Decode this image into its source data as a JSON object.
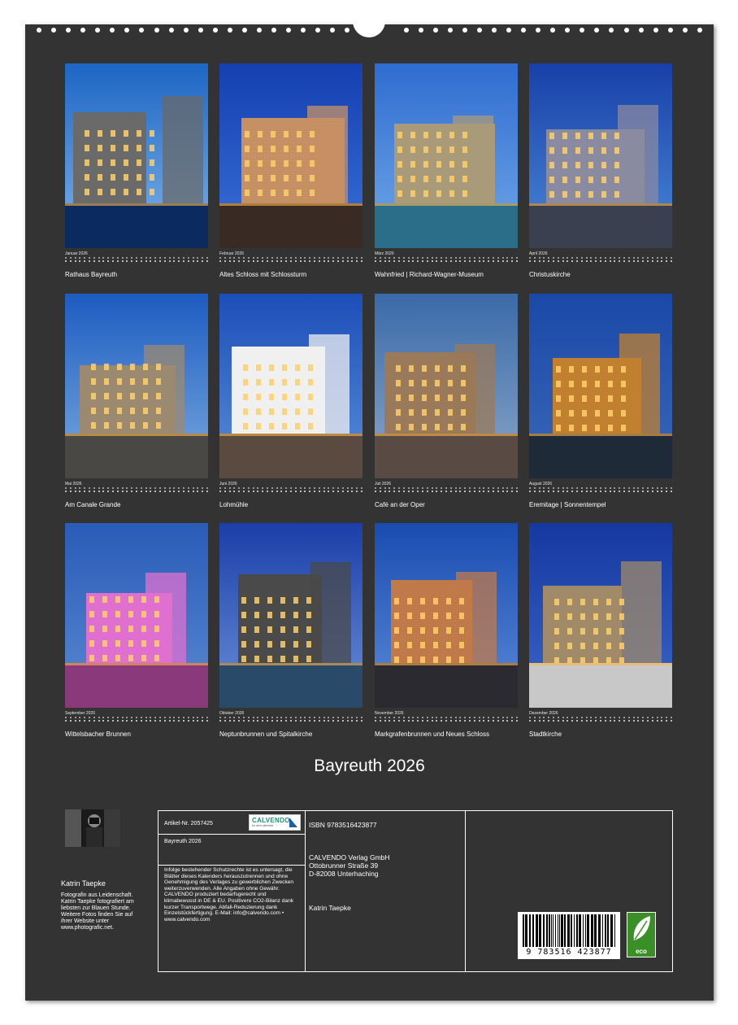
{
  "calendar": {
    "title": "Bayreuth 2026",
    "months": [
      {
        "month_label": "Januar 2026",
        "caption": "Rathaus Bayreuth",
        "sky": "#1d66c4",
        "sky_low": "#7db2ea",
        "ground": "#0b2a60",
        "accent": "#6a6a6a"
      },
      {
        "month_label": "Februar 2026",
        "caption": "Altes Schloss mit Schlossturm",
        "sky": "#1440b0",
        "sky_low": "#3a70d8",
        "ground": "#3a2a24",
        "accent": "#c59064"
      },
      {
        "month_label": "März 2026",
        "caption": "Wahnfried | Richard-Wagner-Museum",
        "sky": "#2f6cd0",
        "sky_low": "#70a8e8",
        "ground": "#2a6e8a",
        "accent": "#a99a7a"
      },
      {
        "month_label": "April 2026",
        "caption": "Christuskirche",
        "sky": "#1840a8",
        "sky_low": "#4a88d8",
        "ground": "#3a4050",
        "accent": "#8a8aa0"
      },
      {
        "month_label": "Mai 2026",
        "caption": "Am Canale Grande",
        "sky": "#1d5cc0",
        "sky_low": "#7aaae0",
        "ground": "#4a4844",
        "accent": "#9c8a70"
      },
      {
        "month_label": "Juni 2026",
        "caption": "Lohmühle",
        "sky": "#1c4eb8",
        "sky_low": "#5a8ed8",
        "ground": "#5a4a40",
        "accent": "#f0f0f0"
      },
      {
        "month_label": "Juli 2026",
        "caption": "Café an der Oper",
        "sky": "#3a6aa8",
        "sky_low": "#8aa6c8",
        "ground": "#5a4a44",
        "accent": "#9a7a5a"
      },
      {
        "month_label": "August 2026",
        "caption": "Eremitage | Sonnentempel",
        "sky": "#1a48a8",
        "sky_low": "#3a68b8",
        "ground": "#1e2a38",
        "accent": "#c08030"
      },
      {
        "month_label": "September 2026",
        "caption": "Wittelsbacher Brunnen",
        "sky": "#2a5cb8",
        "sky_low": "#5a88d0",
        "ground": "#8a3a7a",
        "accent": "#e070d0"
      },
      {
        "month_label": "Oktober 2026",
        "caption": "Neptunbrunnen und Spitalkirche",
        "sky": "#1b3ea8",
        "sky_low": "#6a90d8",
        "ground": "#2a4a6a",
        "accent": "#4a4a4a"
      },
      {
        "month_label": "November 2026",
        "caption": "Markgrafenbrunnen und Neues Schloss",
        "sky": "#1a4cb0",
        "sky_low": "#5a8ad8",
        "ground": "#2a2a30",
        "accent": "#c07a4a"
      },
      {
        "month_label": "Dezember 2026",
        "caption": "Stadtkirche",
        "sky": "#1538a0",
        "sky_low": "#3a66c8",
        "ground": "#c8c8c8",
        "accent": "#a08a6a"
      }
    ]
  },
  "author": {
    "name": "Katrin Taepke",
    "bio": "Fotografin aus Leidenschaft. Katrin Taepke fotografiert am liebsten zur Blauen Stunde. Weitere Fotos finden Sie auf ihrer Website unter www.photografic.net."
  },
  "info": {
    "article_no": "Artikel-Nr. 2057425",
    "product_title": "Bayreuth 2026",
    "legal": "Infolge bestehender Schutzrechte ist es untersagt, die Blätter dieses Kalenders herauszutrennen und ohne Genehmigung des Verlages zu gewerblichen Zwecken weiterzuverwenden. Alle Angaben ohne Gewähr. CALVENDO produziert bedarfsgerecht und klimabewusst in DE & EU. Positivere CO2-Bilanz dank kurzer Transportwege. Abfall-Reduzierung dank Einzelstückfertigung. E-Mail: info@calvendo.com • www.calvendo.com",
    "isbn": "ISBN 9783516423877",
    "publisher_name": "CALVENDO Verlag GmbH",
    "publisher_street": "Ottobrunner Straße 39",
    "publisher_city": "D-82008 Unterhaching",
    "photographer": "Katrin Taepke",
    "logo_word": "CALVENDO",
    "logo_tagline": "for dein calendar",
    "barcode_digits": "9  783516  423877",
    "eco_label": "eco"
  }
}
